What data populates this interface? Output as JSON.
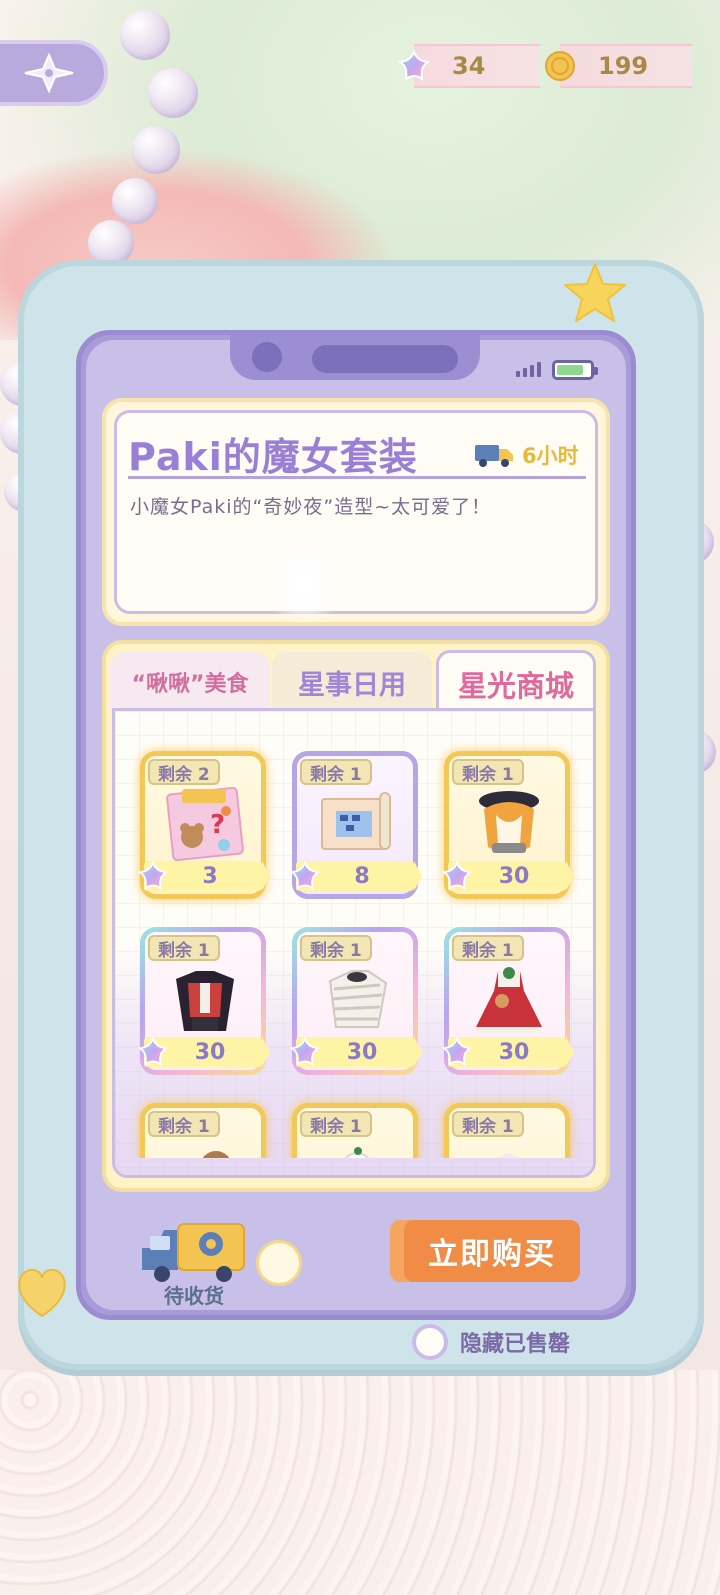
{
  "currencies": {
    "star": {
      "icon": "rainbow-star-icon",
      "value": "34"
    },
    "coin": {
      "icon": "gold-coin-icon",
      "value": "199"
    }
  },
  "product": {
    "title": "Paki的魔女套装",
    "delivery_time": "6小时",
    "description": "小魔女Paki的“奇妙夜”造型~太可爱了！"
  },
  "tabs": [
    {
      "label": "“啾啾”美食",
      "active": false
    },
    {
      "label": "星事日用",
      "active": false
    },
    {
      "label": "星光商城",
      "active": true
    }
  ],
  "items": [
    {
      "remain": "剩余 2",
      "price": "3",
      "frame": "gold",
      "icon": "sticker-pack-icon"
    },
    {
      "remain": "剩余 1",
      "price": "8",
      "frame": "purple",
      "icon": "fabric-set-icon"
    },
    {
      "remain": "剩余 1",
      "price": "30",
      "frame": "gold",
      "icon": "witch-hat-outfit-icon"
    },
    {
      "remain": "剩余 1",
      "price": "30",
      "frame": "rainbow",
      "icon": "vampire-outfit-icon"
    },
    {
      "remain": "剩余 1",
      "price": "30",
      "frame": "rainbow",
      "icon": "mummy-outfit-icon"
    },
    {
      "remain": "剩余 1",
      "price": "30",
      "frame": "rainbow",
      "icon": "christmas-dress-icon"
    },
    {
      "remain": "剩余 1",
      "price": "",
      "frame": "gold",
      "icon": "teddy-item-icon"
    },
    {
      "remain": "剩余 1",
      "price": "",
      "frame": "gold",
      "icon": "snowman-item-icon"
    },
    {
      "remain": "剩余 1",
      "price": "",
      "frame": "gold",
      "icon": "mushroom-item-icon"
    }
  ],
  "footer": {
    "pending_label": "待收货",
    "buy_label": "立即购买",
    "hide_sold_label": "隐藏已售罄"
  },
  "colors": {
    "accent_purple": "#9a7fd6",
    "buy_orange": "#f08c45",
    "price_yellow": "#fff3a6"
  }
}
